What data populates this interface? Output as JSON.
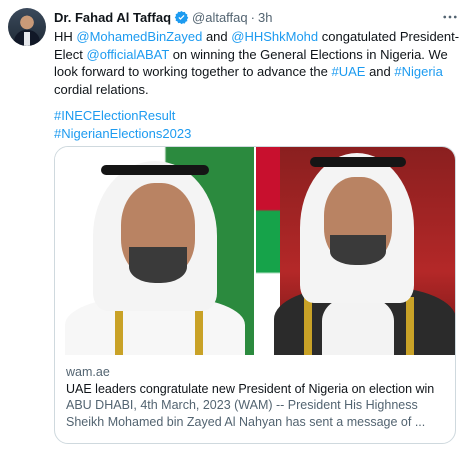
{
  "tweet": {
    "author_name": "Dr. Fahad Al Taffaq",
    "handle": "@altaffaq",
    "separator": "·",
    "time": "3h",
    "text": {
      "t1": "HH ",
      "mention1": "@MohamedBinZayed",
      "t2": " and ",
      "mention2": "@HHShkMohd",
      "t3": " congatulated President-Elect ",
      "mention3": "@officialABAT",
      "t4": " on winning the General Elections in Nigeria. We look forward to working together to advance the ",
      "hashtag1": "#UAE",
      "t5": " and ",
      "hashtag2": "#Nigeria",
      "t6": " cordial relations."
    },
    "hashtags": [
      "#INECElectionResult",
      "#NigerianElections2023"
    ],
    "icons": {
      "verified": "verified-badge-icon",
      "more": "more-options-icon"
    },
    "colors": {
      "link": "#1d9bf0",
      "verified": "#1d9bf0",
      "muted": "#536471",
      "text": "#0f1419"
    }
  },
  "card": {
    "domain": "wam.ae",
    "title": "UAE leaders congratulate new President of Nigeria on election win",
    "description": "ABU DHABI, 4th March, 2023 (WAM) -- President His Highness Sheikh Mohamed bin Zayed Al Nahyan has sent a message of ..."
  }
}
